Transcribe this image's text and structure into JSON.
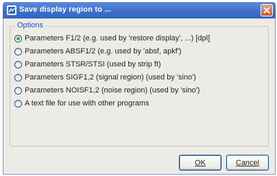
{
  "dialog": {
    "title": "Save display region to ...",
    "icon": "app-icon",
    "close_icon": "close-icon"
  },
  "options_group": {
    "label": "Options",
    "items": [
      {
        "label": "Parameters F1/2 (e.g. used by 'restore display', ...) [dpl]",
        "selected": true
      },
      {
        "label": "Parameters ABSF1/2 (e.g. used by 'absf, apkf')",
        "selected": false
      },
      {
        "label": "Parameters STSR/STSI (used by strip ft)",
        "selected": false
      },
      {
        "label": "Parameters SIGF1,2 (signal region) (used by 'sino')",
        "selected": false
      },
      {
        "label": "Parameters NOISF1,2 (noise region) (used by 'sino')",
        "selected": false
      },
      {
        "label": "A text file for use with other programs",
        "selected": false
      }
    ]
  },
  "buttons": {
    "ok_label": "OK",
    "cancel_label": "Cancel"
  },
  "colors": {
    "titlebar": "#3b6ecb",
    "dialog_bg": "#ecebe5",
    "close_button": "#d3552f",
    "radio_selected": "#3cb33c",
    "legend_text": "#1f4fb0"
  }
}
